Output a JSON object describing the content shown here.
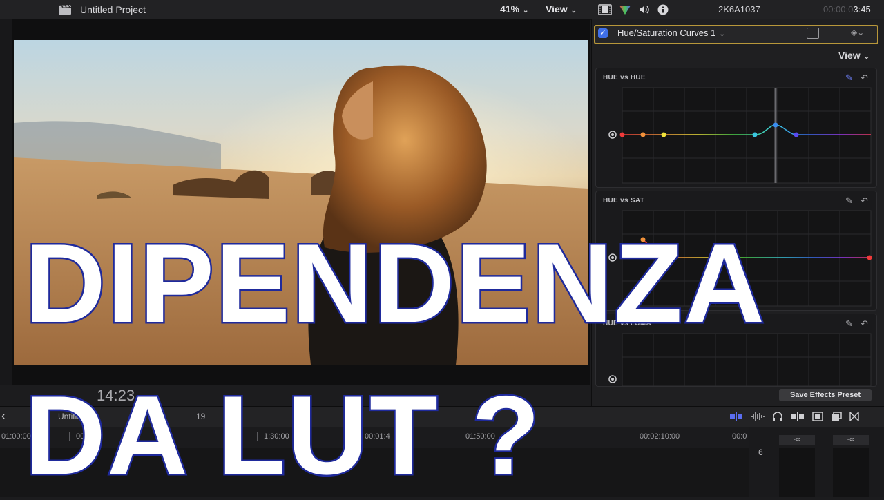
{
  "top_bar": {
    "project_title": "Untitled Project",
    "zoom": "41%",
    "view": "View",
    "clip_name": "2K6A1037",
    "timecode_dim": "00:00:0",
    "timecode": "3:45"
  },
  "viewer": {
    "timecode": "14:23"
  },
  "inspector": {
    "effect_name": "Hue/Saturation Curves 1",
    "effect_enabled": true,
    "view": "View",
    "curves": [
      {
        "title": "HUE vs HUE"
      },
      {
        "title": "HUE vs SAT"
      },
      {
        "title": "HUE vs LUMA"
      }
    ],
    "save_preset": "Save Effects Preset"
  },
  "timeline": {
    "project": "Untitled Pr",
    "timecode_partial": "03",
    "timecode_end": "19",
    "ruler_labels": [
      "01:00:00",
      "00:01",
      "1:30:00",
      "00:01:4",
      "01:50:00",
      "00:02:10:00",
      "00:0"
    ],
    "meter_peak_left": "-∞",
    "meter_peak_right": "-∞",
    "meter_scale_top": "6"
  },
  "overlay": {
    "line1": "DIPENDENZA",
    "line2": "DA LUT ?"
  },
  "colors": {
    "accent_yellow": "#b8973a",
    "checkbox_blue": "#3f6fe8",
    "overlay_stroke": "#1f2a9c",
    "timecode_yellow": "#d9b640"
  }
}
